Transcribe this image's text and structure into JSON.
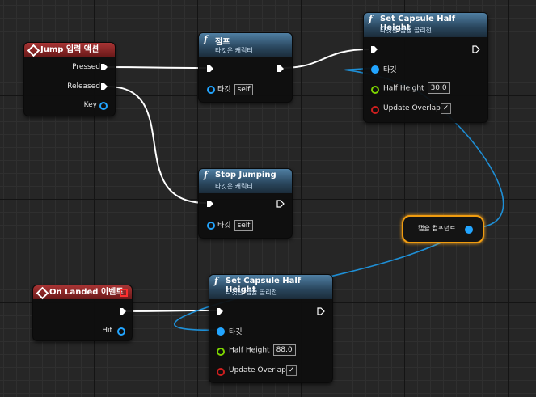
{
  "jump_event": {
    "title": "Jump 입력 액션",
    "pins": {
      "pressed": "Pressed",
      "released": "Released",
      "key": "Key"
    }
  },
  "jump_node": {
    "title": "점프",
    "subtitle": "타깃은 캐릭터",
    "target_label": "타깃",
    "target_value": "self"
  },
  "stop_jumping_node": {
    "title": "Stop Jumping",
    "subtitle": "타깃은 캐릭터",
    "target_label": "타깃",
    "target_value": "self"
  },
  "set_capsule_top": {
    "title": "Set Capsule Half Height",
    "subtitle": "타깃은 캡슐 콜리전",
    "target_label": "타깃",
    "half_height_label": "Half Height",
    "half_height_value": "30.0",
    "update_overlaps_label": "Update Overlaps",
    "update_overlaps_checked": true
  },
  "capsule_component": {
    "label": "캡슐 컴포넌트"
  },
  "on_landed_event": {
    "title": "On Landed 이벤트",
    "hit_label": "Hit"
  },
  "set_capsule_bottom": {
    "title": "Set Capsule Half Height",
    "subtitle": "타깃은 캡슐 콜리전",
    "target_label": "타깃",
    "half_height_label": "Half Height",
    "half_height_value": "88.0",
    "update_overlaps_label": "Update Overlaps",
    "update_overlaps_checked": true
  },
  "colors": {
    "exec_wire": "#ffffff",
    "object_wire": "#1e8fd6",
    "event_header": "#a83434",
    "function_header": "#4f7fa3",
    "selected_outline": "#f09c10"
  },
  "check_glyph": "✓"
}
